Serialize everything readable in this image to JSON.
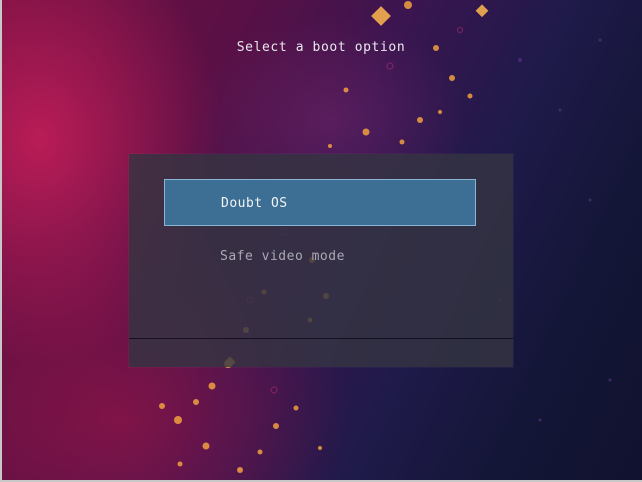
{
  "screen": {
    "title": "Select a boot option"
  },
  "boot_menu": {
    "options": [
      {
        "label": "Doubt OS",
        "selected": true
      },
      {
        "label": "Safe video mode",
        "selected": false
      }
    ]
  },
  "colors": {
    "selected_background": "#3c6f93",
    "selected_border": "#8ab4d4",
    "panel": "#343442"
  }
}
